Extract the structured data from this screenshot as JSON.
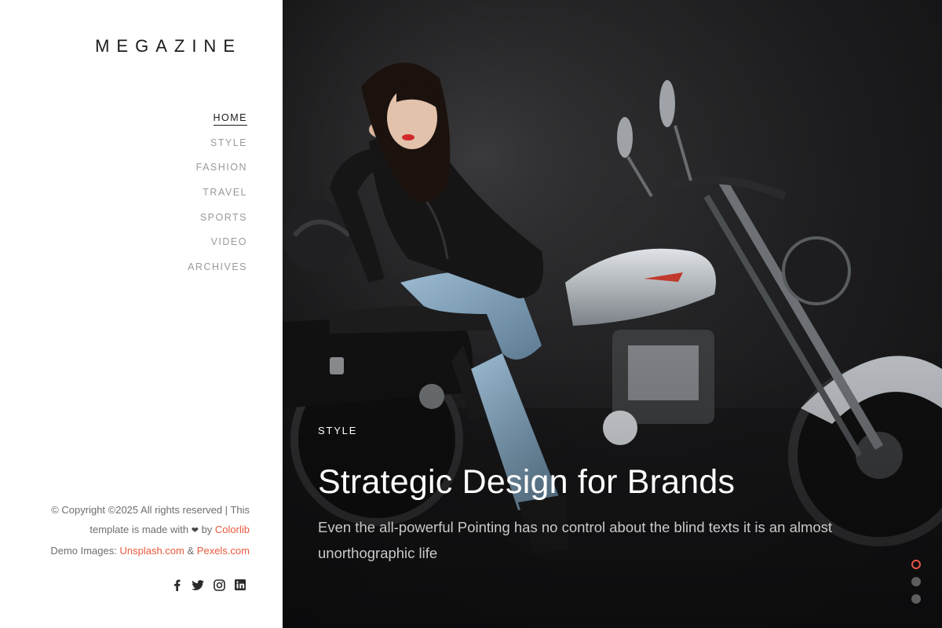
{
  "brand": {
    "name": "MEGAZINE"
  },
  "nav": {
    "items": [
      {
        "label": "HOME",
        "active": true
      },
      {
        "label": "STYLE",
        "active": false
      },
      {
        "label": "FASHION",
        "active": false
      },
      {
        "label": "TRAVEL",
        "active": false
      },
      {
        "label": "SPORTS",
        "active": false
      },
      {
        "label": "VIDEO",
        "active": false
      },
      {
        "label": "ARCHIVES",
        "active": false
      }
    ]
  },
  "footer": {
    "copyright": "© Copyright ©2025 All rights reserved | This",
    "made_with": "template is made with",
    "heart": "❤",
    "by": "by",
    "colorlib": "Colorlib",
    "demo_images": "Demo Images:",
    "unsplash": "Unsplash.com",
    "amp": "&",
    "pexels": "Pexels.com"
  },
  "social": {
    "icons": [
      "facebook-icon",
      "twitter-icon",
      "instagram-icon",
      "linkedin-icon"
    ]
  },
  "hero": {
    "category": "STYLE",
    "title": "Strategic Design for Brands",
    "excerpt": "Even the all-powerful Pointing has no control about the blind texts it is an almost unorthographic life",
    "slides": {
      "count": 3,
      "active_index": 0
    }
  },
  "colors": {
    "accent": "#ea5a3c",
    "dot_active": "#e8554a",
    "hero_bg": "#1b1b1d",
    "text_dark": "#1a1a1a",
    "nav_muted": "#9a9a9a"
  }
}
